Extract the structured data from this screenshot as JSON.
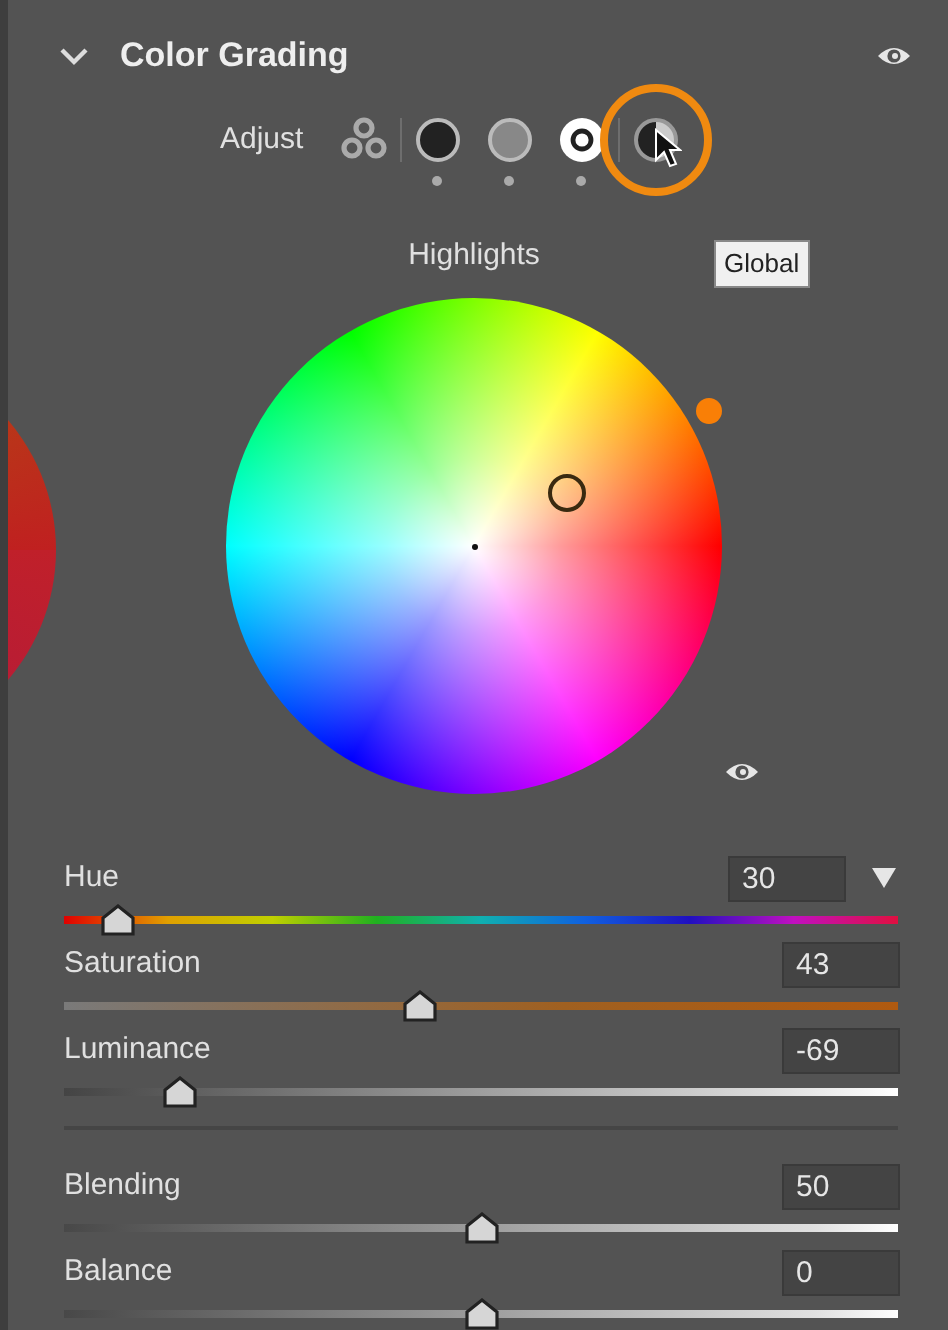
{
  "panel": {
    "title": "Color Grading",
    "expanded": true
  },
  "adjust": {
    "label": "Adjust",
    "modes": [
      {
        "kind": "all",
        "selected": false,
        "highlighted": false
      },
      {
        "kind": "shadows",
        "selected": false,
        "highlighted": false
      },
      {
        "kind": "midtones",
        "selected": false,
        "highlighted": false
      },
      {
        "kind": "highlights",
        "selected": true,
        "highlighted": false
      },
      {
        "kind": "global",
        "selected": false,
        "highlighted": true
      }
    ],
    "tooltip": "Global"
  },
  "wheel": {
    "label": "Highlights"
  },
  "sliders": [
    {
      "kind": "hue",
      "label": "Hue",
      "value": "30",
      "level": 0.083,
      "menu": true
    },
    {
      "kind": "saturation",
      "label": "Saturation",
      "value": "43",
      "level": 0.43,
      "menu": false
    },
    {
      "kind": "luminance",
      "label": "Luminance",
      "value": "-69",
      "level": 0.155,
      "menu": false
    },
    {
      "kind": "plain",
      "label": "Blending",
      "value": "50",
      "level": 0.5,
      "menu": false
    },
    {
      "kind": "plain",
      "label": "Balance",
      "value": "0",
      "level": 0.5,
      "menu": false
    }
  ]
}
